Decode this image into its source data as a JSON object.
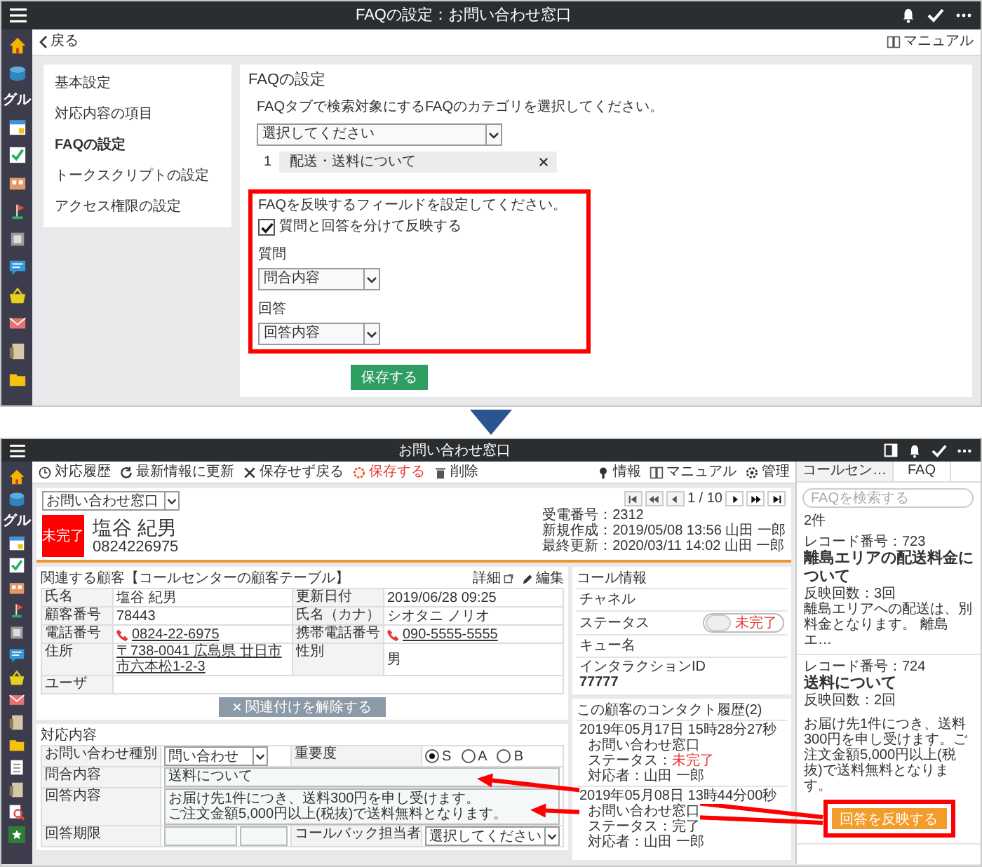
{
  "top": {
    "header": {
      "title": "FAQの設定：お問い合わせ窓口"
    },
    "rail_label": "グル",
    "back": "戻る",
    "manual": "マニュアル",
    "menu": [
      {
        "label": "基本設定",
        "selected": false
      },
      {
        "label": "対応内容の項目",
        "selected": false
      },
      {
        "label": "FAQの設定",
        "selected": true
      },
      {
        "label": "トークスクリプトの設定",
        "selected": false
      },
      {
        "label": "アクセス権限の設定",
        "selected": false
      }
    ],
    "settings": {
      "title": "FAQの設定",
      "instruction": "FAQタブで検索対象にするFAQのカテゴリを選択してください。",
      "category_select": "選択してください",
      "categories": [
        {
          "number": "1",
          "label": "配送・送料について"
        }
      ],
      "field_instruction": "FAQを反映するフィールドを設定してください。",
      "split": {
        "label": "質問と回答を分けて反映する",
        "checked": true
      },
      "fields": [
        {
          "label": "質問",
          "value": "問合内容"
        },
        {
          "label": "回答",
          "value": "回答内容"
        }
      ],
      "save": "保存する"
    }
  },
  "bottom": {
    "header": {
      "title": "お問い合わせ窓口"
    },
    "rail_label": "グル",
    "toolbar": [
      {
        "label": "対応履歴",
        "kind": "history"
      },
      {
        "label": "最新情報に更新",
        "kind": "refresh"
      },
      {
        "label": "保存せず戻る",
        "kind": "discard"
      },
      {
        "label": "保存する",
        "kind": "save"
      },
      {
        "label": "削除",
        "kind": "delete"
      }
    ],
    "toolbar_right": [
      {
        "label": "情報",
        "kind": "info"
      },
      {
        "label": "マニュアル",
        "kind": "manual"
      },
      {
        "label": "管理",
        "kind": "admin"
      }
    ],
    "record": {
      "app_select": "お問い合わせ窓口",
      "status": "未完了",
      "name": "塩谷 紀男",
      "phone": "0824226975",
      "pager": "1 / 10",
      "reception": "受電番号：2312",
      "created": "新規作成：2019/05/08 13:56 山田 一郎",
      "updated": "最終更新：2020/03/11 14:02 山田 一郎"
    },
    "customer": {
      "title": "関連する顧客【コールセンターの顧客テーブル】",
      "detail": "詳細",
      "edit": "編集",
      "rows": [
        {
          "cells": [
            {
              "label": "氏名",
              "value": "塩谷 紀男",
              "kind": "text"
            },
            {
              "label": "更新日付",
              "value": "2019/06/28 09:25",
              "kind": "text"
            }
          ]
        },
        {
          "cells": [
            {
              "label": "顧客番号",
              "value": "78443",
              "kind": "text"
            },
            {
              "label": "氏名（カナ）",
              "value": "シオタニ ノリオ",
              "kind": "text"
            }
          ]
        },
        {
          "cells": [
            {
              "label": "電話番号",
              "value": "0824-22-6975",
              "kind": "phone"
            },
            {
              "label": "携帯電話番号",
              "value": "090-5555-5555",
              "kind": "phone"
            }
          ]
        },
        {
          "cells": [
            {
              "label": "住所",
              "value": "〒738-0041 広島県 廿日市市六本松1-2-3",
              "kind": "address"
            },
            {
              "label": "性別",
              "value": "男",
              "kind": "text"
            }
          ]
        },
        {
          "cells": [
            {
              "label": "ユーザ",
              "kind": "text"
            }
          ]
        }
      ],
      "unlink": "関連付けを解除する"
    },
    "response": {
      "title": "対応内容",
      "inquiry_type": {
        "label": "お問い合わせ種別",
        "value": "問い合わせ"
      },
      "priority": {
        "label": "重要度",
        "options": [
          {
            "label": "S",
            "selected": true
          },
          {
            "label": "A",
            "selected": false
          },
          {
            "label": "B",
            "selected": false
          }
        ]
      },
      "question": {
        "label": "問合内容",
        "value": "送料について"
      },
      "answer": {
        "label": "回答内容",
        "lines": [
          "お届け先1件につき、送料300円を申し受けます。",
          "ご注文金額5,000円以上(税抜)で送料無料となります。"
        ]
      },
      "deadline": {
        "label": "回答期限"
      },
      "callback": {
        "label": "コールバック担当者",
        "value": "選択してください"
      }
    },
    "call_info": {
      "title": "コール情報",
      "channel": "チャネル",
      "status_label": "ステータス",
      "status_value": "未完了",
      "on": false,
      "queue": "キュー名",
      "interaction_label": "インタラクションID",
      "interaction_id": "77777"
    },
    "history": {
      "title": "この顧客のコンタクト履歴(2)",
      "entries": [
        {
          "datetime": "2019年05月17日 15時28分27秒",
          "app": "お問い合わせ窓口",
          "status_label": "ステータス：",
          "status": "未完了",
          "done": false,
          "agent": "対応者：山田 一郎"
        },
        {
          "datetime": "2019年05月08日 13時44分00秒",
          "app": "お問い合わせ窓口",
          "status_label": "ステータス：",
          "status": "完了",
          "done": true,
          "agent": "対応者：山田 一郎"
        }
      ]
    },
    "faq": {
      "tabs": [
        {
          "label": "コールセン…",
          "selected": false
        },
        {
          "label": "FAQ",
          "selected": true
        }
      ],
      "search_placeholder": "FAQを検索する",
      "count": "2件",
      "items": [
        {
          "record": "レコード番号：723",
          "title": "離島エリアの配送料金について",
          "uses": "反映回数：3回",
          "body": "離島エリアへの配送は、別料金となります。 離島エ…"
        },
        {
          "record": "レコード番号：724",
          "title": "送料について",
          "uses": "反映回数：2回",
          "body": "お届け先1件につき、送料300円を申し受けます。ご注文金額5,000円以上(税抜)で送料無料となります。",
          "action": "回答を反映する"
        }
      ]
    }
  }
}
